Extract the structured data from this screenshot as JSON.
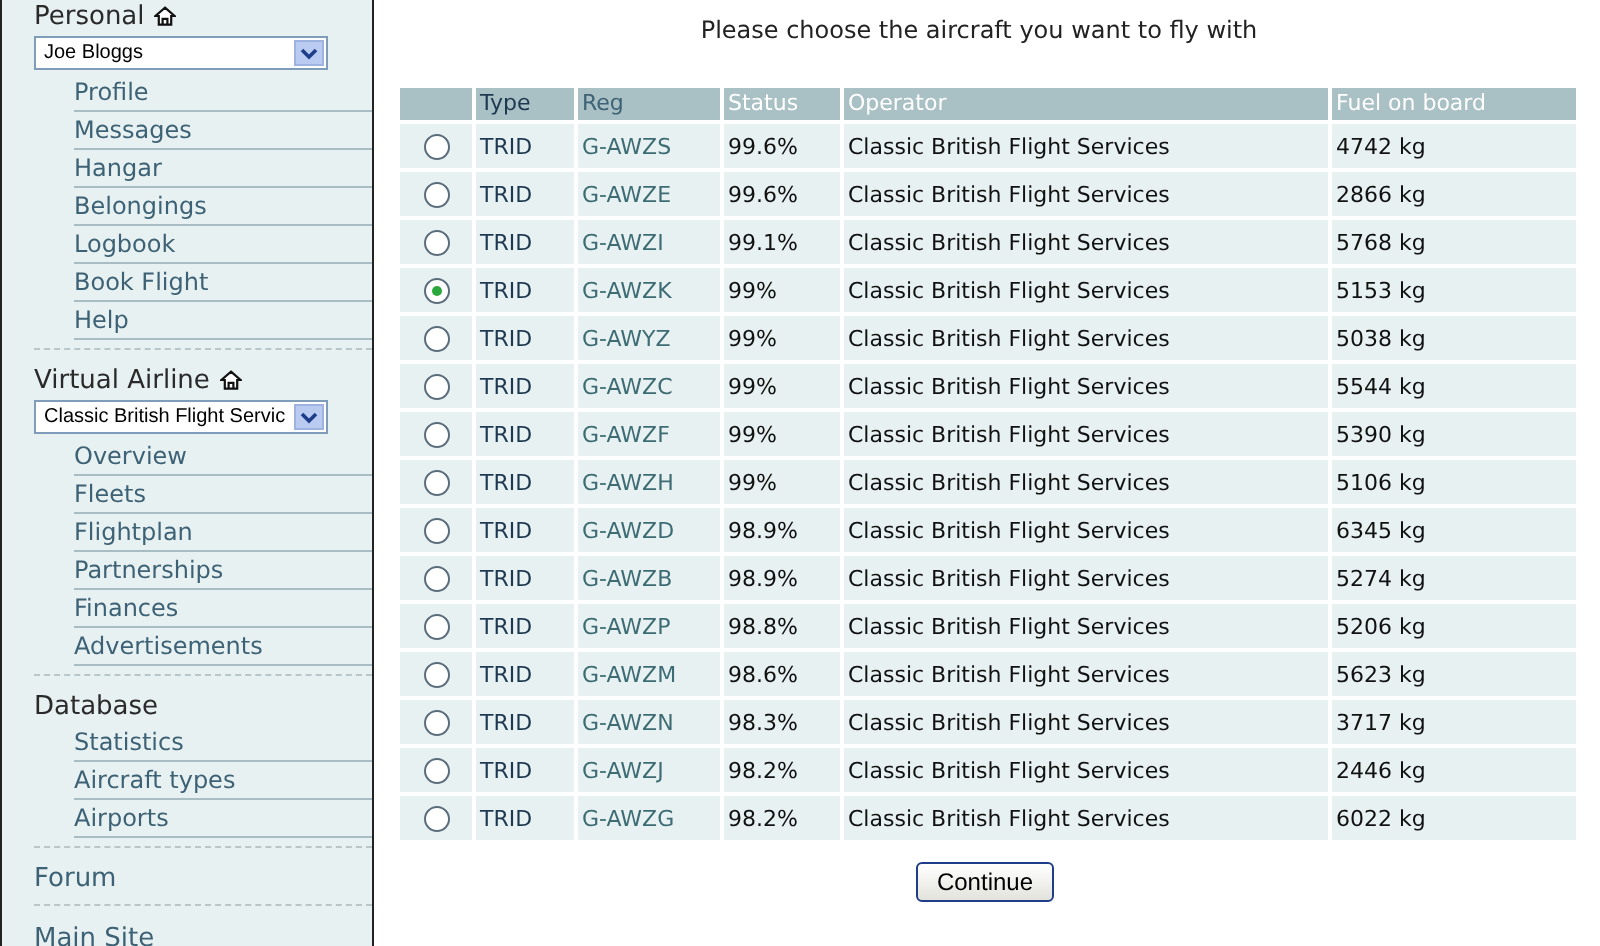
{
  "sidebar": {
    "sections": [
      {
        "title": "Personal",
        "home": true,
        "select": "Joe Bloggs",
        "items": [
          {
            "label": "Profile"
          },
          {
            "label": "Messages"
          },
          {
            "label": "Hangar"
          },
          {
            "label": "Belongings"
          },
          {
            "label": "Logbook"
          },
          {
            "label": "Book Flight"
          },
          {
            "label": "Help"
          }
        ]
      },
      {
        "title": "Virtual Airline",
        "home": true,
        "select": "Classic British Flight Servic",
        "items": [
          {
            "label": "Overview"
          },
          {
            "label": "Fleets"
          },
          {
            "label": "Flightplan"
          },
          {
            "label": "Partnerships"
          },
          {
            "label": "Finances"
          },
          {
            "label": "Advertisements"
          }
        ]
      },
      {
        "title": "Database",
        "kind": "plain",
        "items": [
          {
            "label": "Statistics"
          },
          {
            "label": "Aircraft types"
          },
          {
            "label": "Airports"
          }
        ]
      },
      {
        "title": "Forum",
        "kind": "link"
      },
      {
        "title": "Main Site",
        "kind": "link"
      }
    ]
  },
  "main": {
    "heading": "Please choose the aircraft you want to fly with",
    "table": {
      "columns": [
        "Type",
        "Reg",
        "Status",
        "Operator",
        "Fuel on board"
      ],
      "rows": [
        {
          "selected": false,
          "cells": [
            "TRID",
            "G-AWZS",
            "99.6%",
            "Classic British Flight Services",
            "4742 kg"
          ]
        },
        {
          "selected": false,
          "cells": [
            "TRID",
            "G-AWZE",
            "99.6%",
            "Classic British Flight Services",
            "2866 kg"
          ]
        },
        {
          "selected": false,
          "cells": [
            "TRID",
            "G-AWZI",
            "99.1%",
            "Classic British Flight Services",
            "5768 kg"
          ]
        },
        {
          "selected": true,
          "cells": [
            "TRID",
            "G-AWZK",
            "99%",
            "Classic British Flight Services",
            "5153 kg"
          ]
        },
        {
          "selected": false,
          "cells": [
            "TRID",
            "G-AWYZ",
            "99%",
            "Classic British Flight Services",
            "5038 kg"
          ]
        },
        {
          "selected": false,
          "cells": [
            "TRID",
            "G-AWZC",
            "99%",
            "Classic British Flight Services",
            "5544 kg"
          ]
        },
        {
          "selected": false,
          "cells": [
            "TRID",
            "G-AWZF",
            "99%",
            "Classic British Flight Services",
            "5390 kg"
          ]
        },
        {
          "selected": false,
          "cells": [
            "TRID",
            "G-AWZH",
            "99%",
            "Classic British Flight Services",
            "5106 kg"
          ]
        },
        {
          "selected": false,
          "cells": [
            "TRID",
            "G-AWZD",
            "98.9%",
            "Classic British Flight Services",
            "6345 kg"
          ]
        },
        {
          "selected": false,
          "cells": [
            "TRID",
            "G-AWZB",
            "98.9%",
            "Classic British Flight Services",
            "5274 kg"
          ]
        },
        {
          "selected": false,
          "cells": [
            "TRID",
            "G-AWZP",
            "98.8%",
            "Classic British Flight Services",
            "5206 kg"
          ]
        },
        {
          "selected": false,
          "cells": [
            "TRID",
            "G-AWZM",
            "98.6%",
            "Classic British Flight Services",
            "5623 kg"
          ]
        },
        {
          "selected": false,
          "cells": [
            "TRID",
            "G-AWZN",
            "98.3%",
            "Classic British Flight Services",
            "3717 kg"
          ]
        },
        {
          "selected": false,
          "cells": [
            "TRID",
            "G-AWZJ",
            "98.2%",
            "Classic British Flight Services",
            "2446 kg"
          ]
        },
        {
          "selected": false,
          "cells": [
            "TRID",
            "G-AWZG",
            "98.2%",
            "Classic British Flight Services",
            "6022 kg"
          ]
        }
      ]
    },
    "button": "Continue"
  }
}
